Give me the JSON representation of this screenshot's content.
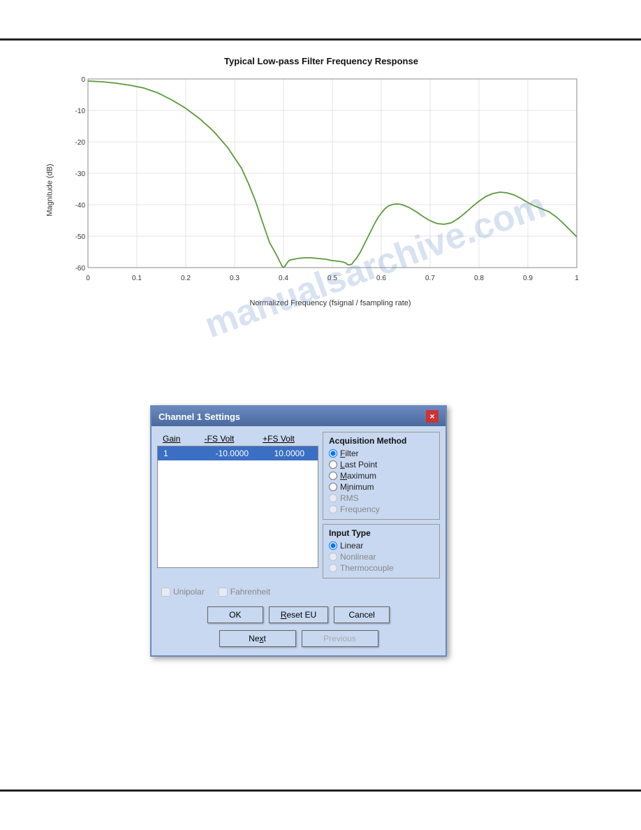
{
  "page": {
    "background": "#ffffff"
  },
  "chart": {
    "title": "Typical Low-pass Filter Frequency Response",
    "y_axis_label": "Magnitude (dB)",
    "x_axis_label": "Normalized Frequency (fsignal / fsampling rate)",
    "y_ticks": [
      "0",
      "-10",
      "-20",
      "-30",
      "-40",
      "-50",
      "-60"
    ],
    "x_ticks": [
      "0",
      "0.1",
      "0.2",
      "0.3",
      "0.4",
      "0.5",
      "0.6",
      "0.7",
      "0.8",
      "0.9",
      "1"
    ]
  },
  "dialog": {
    "title": "Channel 1 Settings",
    "close_label": "×",
    "table": {
      "headers": [
        "Gain",
        "-FS Volt",
        "+FS Volt"
      ],
      "rows": [
        {
          "gain": "1",
          "neg_fs": "-10.0000",
          "pos_fs": "10.0000",
          "selected": true
        }
      ]
    },
    "acquisition": {
      "title": "Acquisition Method",
      "options": [
        {
          "label": "Filter",
          "underline": "F",
          "selected": true,
          "enabled": true
        },
        {
          "label": "Last Point",
          "underline": "L",
          "selected": false,
          "enabled": true
        },
        {
          "label": "Maximum",
          "underline": "M",
          "selected": false,
          "enabled": true
        },
        {
          "label": "Minimum",
          "underline": "i",
          "selected": false,
          "enabled": true
        },
        {
          "label": "RMS",
          "underline": "R",
          "selected": false,
          "enabled": false
        },
        {
          "label": "Frequency",
          "underline": "q",
          "selected": false,
          "enabled": false
        }
      ]
    },
    "input_type": {
      "title": "Input Type",
      "options": [
        {
          "label": "Linear",
          "selected": true,
          "enabled": true
        },
        {
          "label": "Nonlinear",
          "selected": false,
          "enabled": false
        },
        {
          "label": "Thermocouple",
          "selected": false,
          "enabled": false
        }
      ]
    },
    "checkboxes": [
      {
        "label": "Unipolar",
        "checked": false,
        "enabled": false
      },
      {
        "label": "Fahrenheit",
        "checked": false,
        "enabled": false
      }
    ],
    "buttons": [
      {
        "label": "OK",
        "name": "ok-button"
      },
      {
        "label": "Reset EU",
        "name": "reset-eu-button"
      },
      {
        "label": "Cancel",
        "name": "cancel-button"
      }
    ],
    "nav_buttons": [
      {
        "label": "Next",
        "name": "next-button",
        "enabled": true
      },
      {
        "label": "Previous",
        "name": "previous-button",
        "enabled": false
      }
    ]
  },
  "watermark": {
    "line1": "manualsarchive.com"
  }
}
